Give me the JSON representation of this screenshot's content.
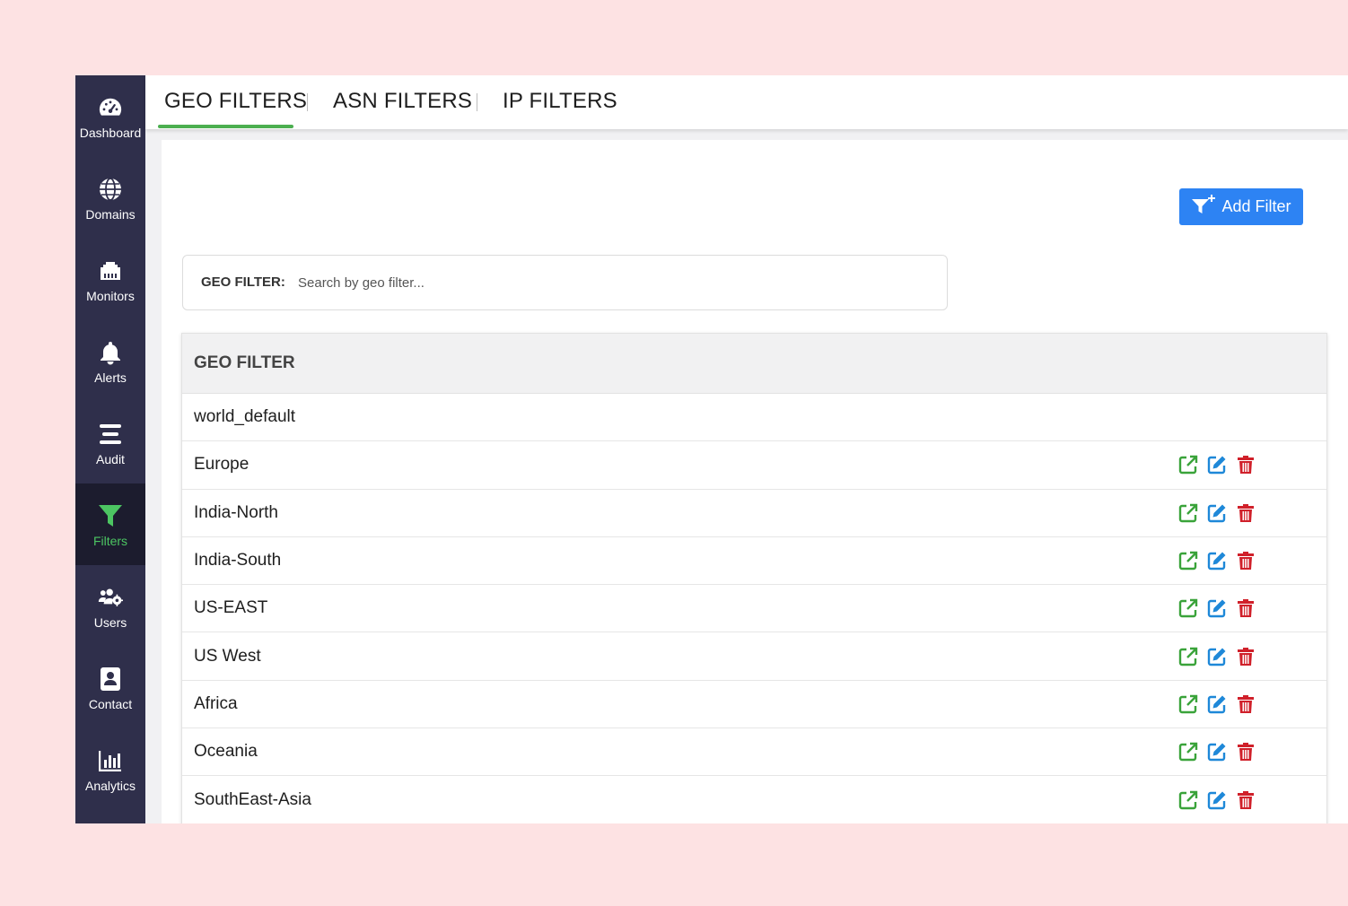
{
  "sidebar": {
    "items": [
      {
        "label": "Dashboard",
        "icon": "gauge-icon"
      },
      {
        "label": "Domains",
        "icon": "globe-icon"
      },
      {
        "label": "Monitors",
        "icon": "ethernet-icon"
      },
      {
        "label": "Alerts",
        "icon": "bell-icon"
      },
      {
        "label": "Audit",
        "icon": "list-icon"
      },
      {
        "label": "Filters",
        "icon": "filter-icon",
        "active": true
      },
      {
        "label": "Users",
        "icon": "users-cog-icon"
      },
      {
        "label": "Contact",
        "icon": "contact-book-icon"
      },
      {
        "label": "Analytics",
        "icon": "bar-chart-icon"
      }
    ]
  },
  "tabs": {
    "geo": "GEO FILTERS",
    "asn": "ASN FILTERS",
    "ip": "IP FILTERS",
    "active": "geo"
  },
  "toolbar": {
    "add_filter_label": "Add Filter"
  },
  "search": {
    "label": "GEO FILTER:",
    "placeholder": "Search by geo filter...",
    "value": ""
  },
  "table": {
    "header": "GEO FILTER",
    "rows": [
      {
        "name": "world_default",
        "actions": false
      },
      {
        "name": "Europe",
        "actions": true
      },
      {
        "name": "India-North",
        "actions": true
      },
      {
        "name": "India-South",
        "actions": true
      },
      {
        "name": "US-EAST",
        "actions": true
      },
      {
        "name": "US West",
        "actions": true
      },
      {
        "name": "Africa",
        "actions": true
      },
      {
        "name": "Oceania",
        "actions": true
      },
      {
        "name": "SouthEast-Asia",
        "actions": true
      }
    ]
  },
  "colors": {
    "sidebar_bg": "#2f2f4b",
    "active_green": "#4cc562",
    "primary_blue": "#2d83f3",
    "open_green": "#3aa33a",
    "edit_blue": "#1e88d8",
    "delete_red": "#d0202a"
  }
}
